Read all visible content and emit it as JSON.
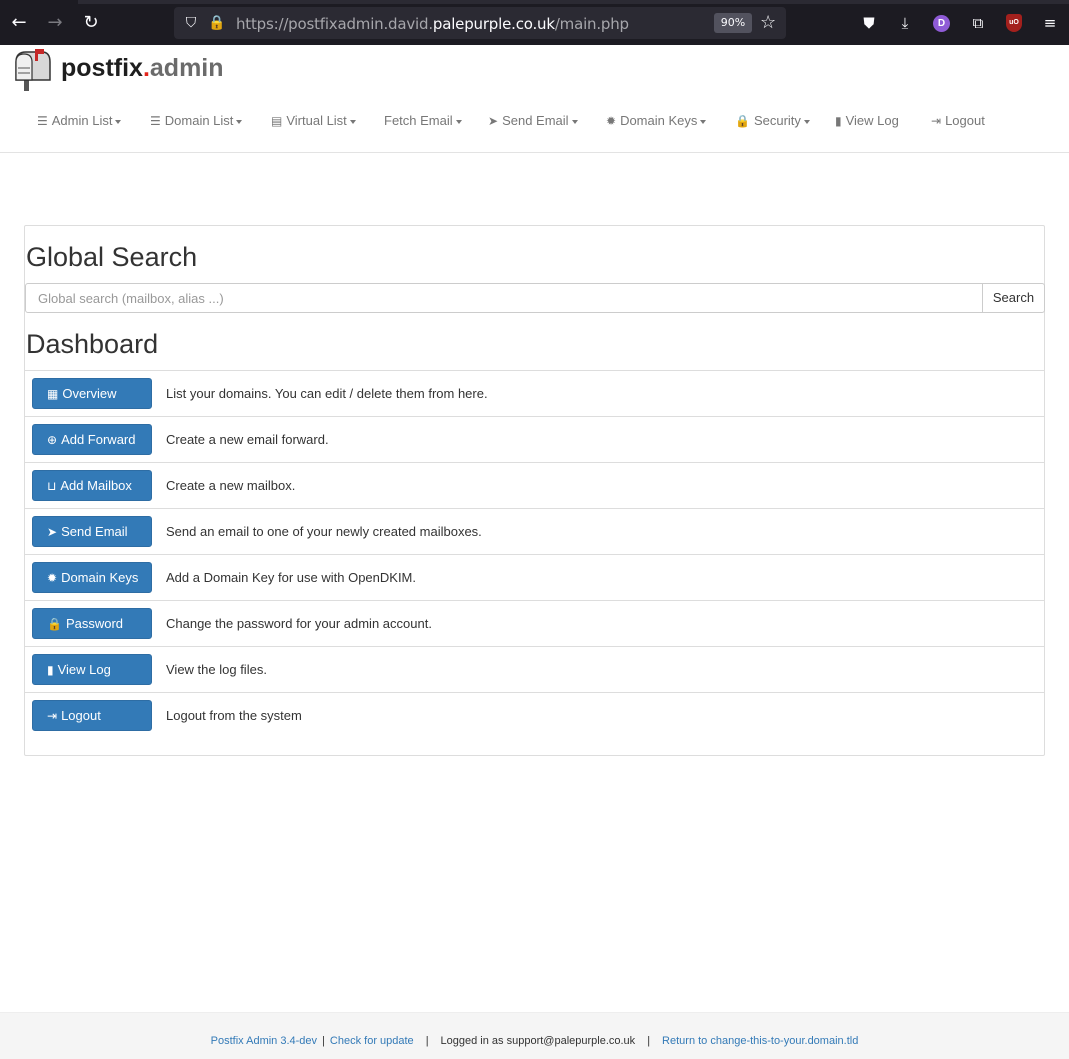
{
  "browser": {
    "url_prefix": "https://postfixadmin.david.",
    "url_domain": "palepurple.co.uk",
    "url_path": "/main.php",
    "zoom": "90%",
    "profile_initial": "D",
    "ublock_label": "uO"
  },
  "logo": {
    "part1": "postfix",
    "dot": ".",
    "part2": "admin"
  },
  "nav": {
    "items": [
      {
        "label": "Admin List",
        "icon": "list-icon",
        "glyph": "☰",
        "dropdown": true
      },
      {
        "label": "Domain List",
        "icon": "list-icon",
        "glyph": "☰",
        "dropdown": true
      },
      {
        "label": "Virtual List",
        "icon": "list-alt-icon",
        "glyph": "▤",
        "dropdown": true
      },
      {
        "label": "Fetch Email",
        "icon": "",
        "glyph": "",
        "dropdown": true
      },
      {
        "label": "Send Email",
        "icon": "send-icon",
        "glyph": "➤",
        "dropdown": true
      },
      {
        "label": "Domain Keys",
        "icon": "certificate-icon",
        "glyph": "✹",
        "dropdown": true
      },
      {
        "label": "Security",
        "icon": "lock-icon",
        "glyph": "🔒",
        "dropdown": true
      },
      {
        "label": "View Log",
        "icon": "file-icon",
        "glyph": "▮",
        "dropdown": false
      },
      {
        "label": "Logout",
        "icon": "logout-icon",
        "glyph": "⇥",
        "dropdown": false
      }
    ]
  },
  "search": {
    "heading": "Global Search",
    "placeholder": "Global search (mailbox, alias ...)",
    "button": "Search"
  },
  "dashboard": {
    "heading": "Dashboard",
    "rows": [
      {
        "label": "Overview",
        "glyph": "▦",
        "desc": "List your domains. You can edit / delete them from here."
      },
      {
        "label": "Add Forward",
        "glyph": "⊕",
        "desc": "Create a new email forward."
      },
      {
        "label": "Add Mailbox",
        "glyph": "⊔",
        "desc": "Create a new mailbox."
      },
      {
        "label": "Send Email",
        "glyph": "➤",
        "desc": "Send an email to one of your newly created mailboxes."
      },
      {
        "label": "Domain Keys",
        "glyph": "✹",
        "desc": "Add a Domain Key for use with OpenDKIM."
      },
      {
        "label": "Password",
        "glyph": "🔒",
        "desc": "Change the password for your admin account."
      },
      {
        "label": "View Log",
        "glyph": "▮",
        "desc": "View the log files."
      },
      {
        "label": "Logout",
        "glyph": "⇥",
        "desc": "Logout from the system"
      }
    ]
  },
  "footer": {
    "version": "Postfix Admin 3.4-dev",
    "check_update": "Check for update",
    "logged_in": "Logged in as support@palepurple.co.uk",
    "return_link": "Return to change-this-to-your.domain.tld"
  }
}
